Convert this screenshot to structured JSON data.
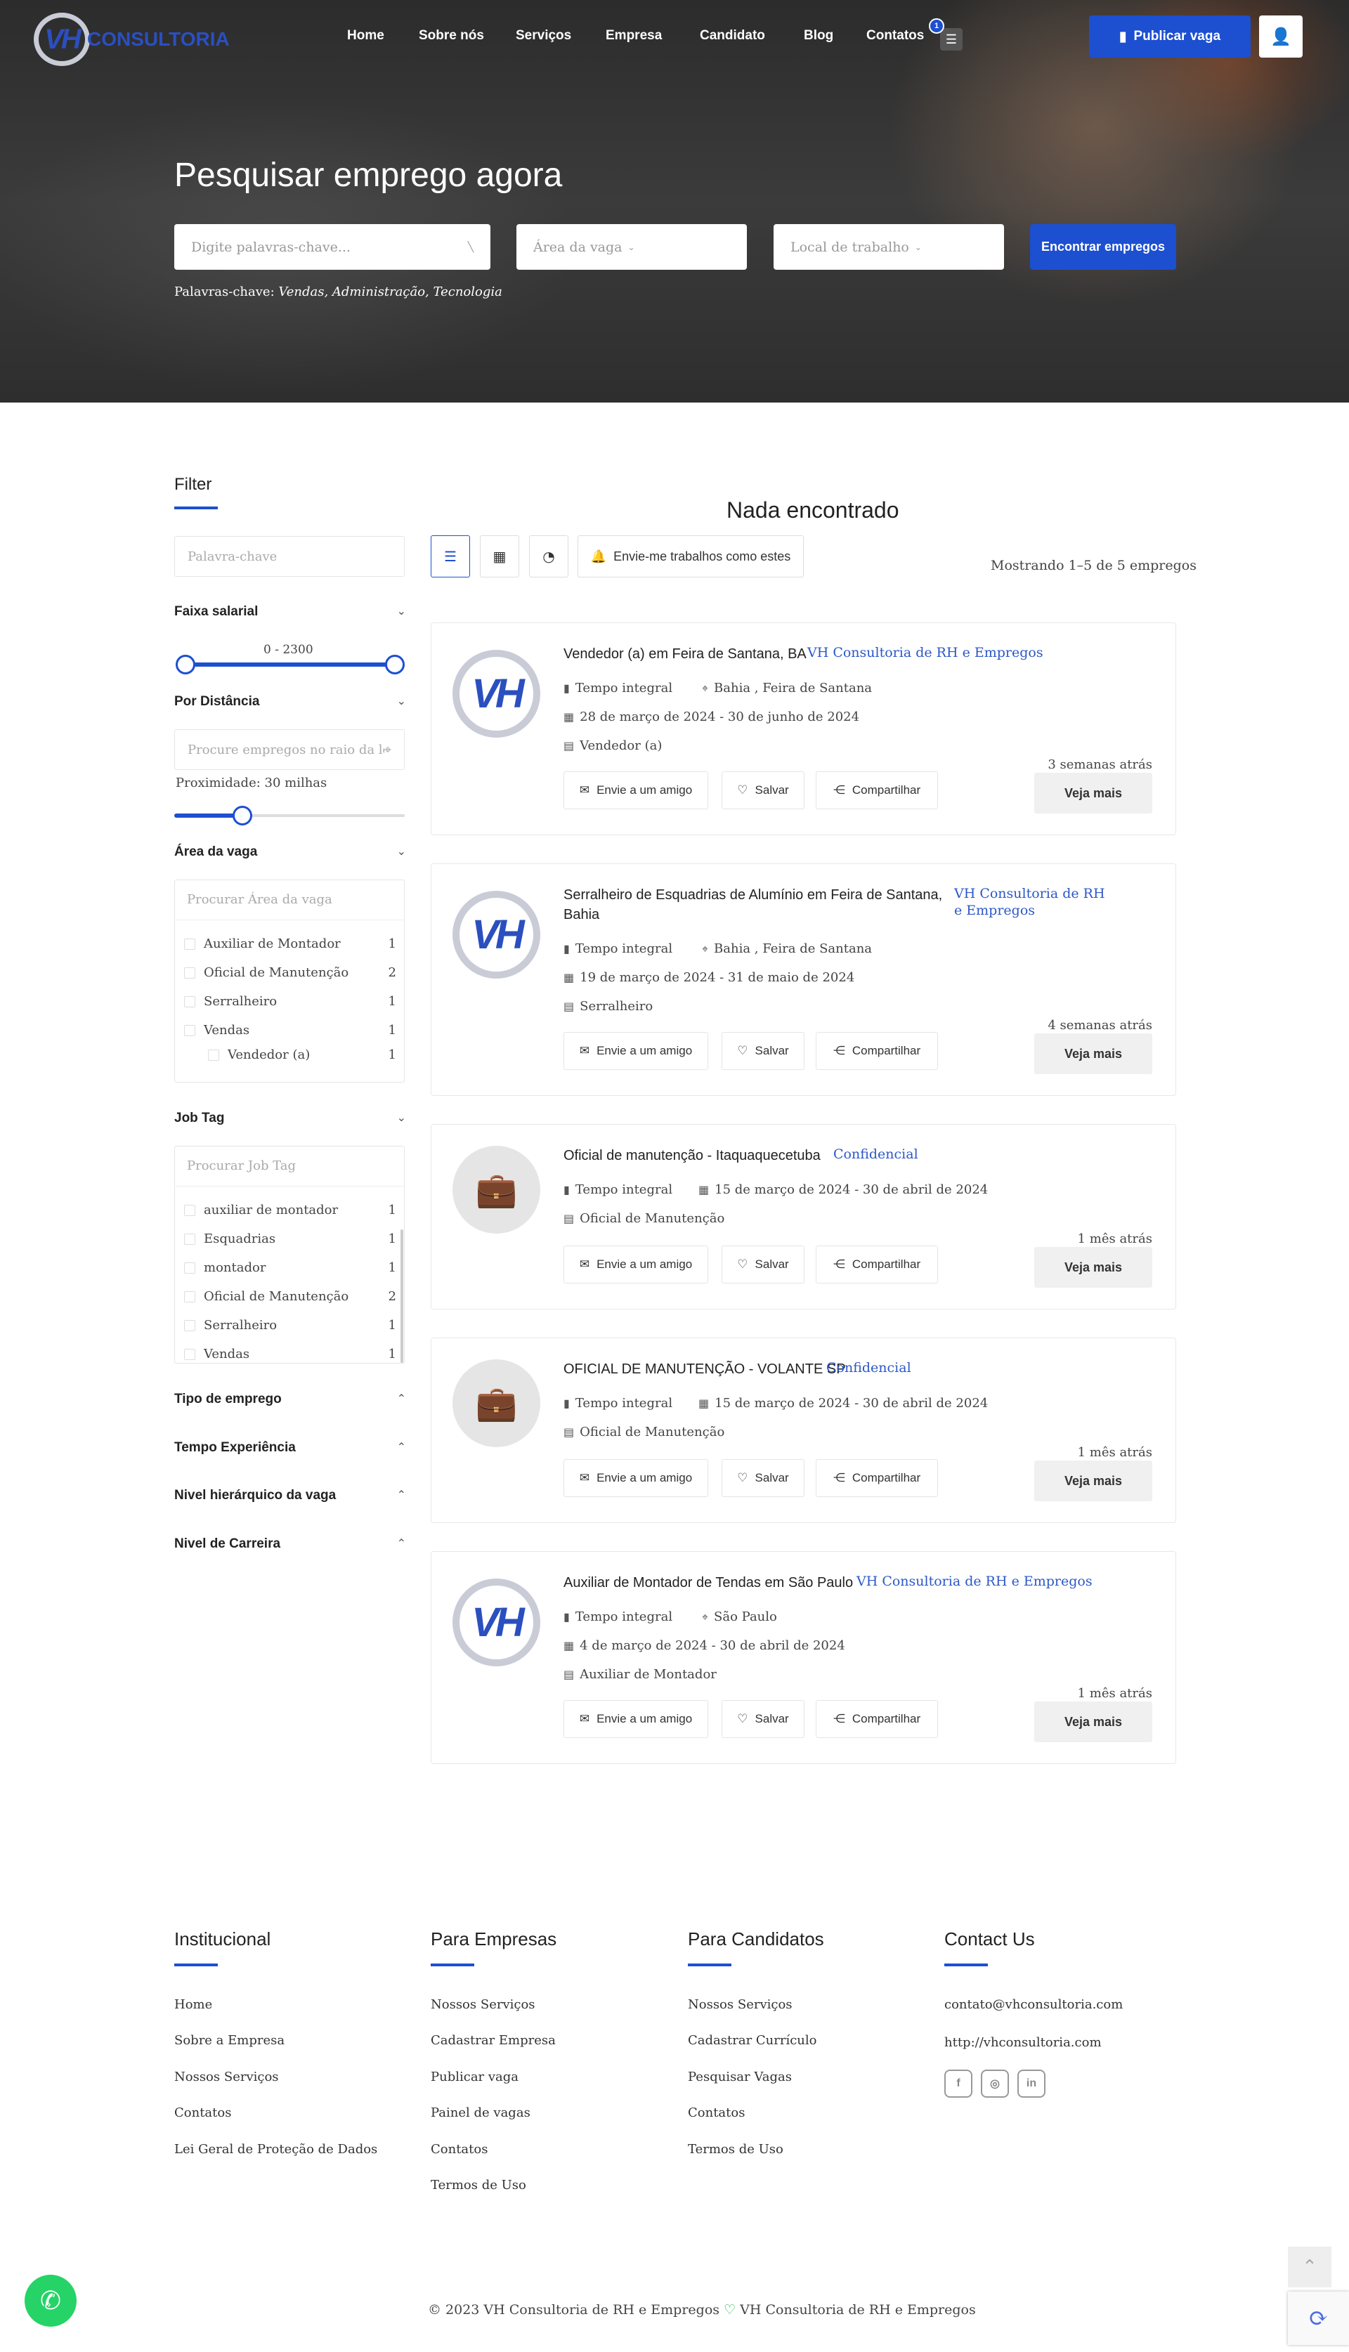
{
  "header": {
    "logo_text": "CONSULTORIA",
    "logo_mark": "VH",
    "nav": [
      "Home",
      "Sobre nós",
      "Serviços",
      "Empresa",
      "Candidato",
      "Blog",
      "Contatos"
    ],
    "cart_count": "1",
    "post_job_label": "Publicar vaga"
  },
  "hero": {
    "title": "Pesquisar emprego agora",
    "keyword_placeholder": "Digite palavras-chave...",
    "area_placeholder": "Área da vaga",
    "location_placeholder": "Local de trabalho",
    "search_button": "Encontrar empregos",
    "keywords_label": "Palavras-chave:",
    "keywords": "Vendas, Administração, Tecnologia"
  },
  "sidebar": {
    "title": "Filter",
    "keyword_placeholder": "Palavra-chave",
    "salary_title": "Faixa salarial",
    "salary_range": "0 - 2300",
    "distance_title": "Por Distância",
    "distance_placeholder": "Procure empregos no raio da localização",
    "proximity_label": "Proximidade: 30 milhas",
    "area_title": "Área da vaga",
    "area_placeholder": "Procurar Área da vaga",
    "areas": [
      {
        "label": "Auxiliar de Montador",
        "count": "1"
      },
      {
        "label": "Oficial de Manutenção",
        "count": "2"
      },
      {
        "label": "Serralheiro",
        "count": "1"
      },
      {
        "label": "Vendas",
        "count": "1"
      },
      {
        "label": "Vendedor (a)",
        "count": "1"
      }
    ],
    "tag_title": "Job Tag",
    "tag_placeholder": "Procurar Job Tag",
    "tags": [
      {
        "label": "auxiliar de montador",
        "count": "1"
      },
      {
        "label": "Esquadrias",
        "count": "1"
      },
      {
        "label": "montador",
        "count": "1"
      },
      {
        "label": "Oficial de Manutenção",
        "count": "2"
      },
      {
        "label": "Serralheiro",
        "count": "1"
      },
      {
        "label": "Vendas",
        "count": "1"
      }
    ],
    "collapsed_sections": [
      "Tipo de emprego",
      "Tempo Experiência",
      "Nivel hierárquico da vaga",
      "Nivel de Carreira"
    ]
  },
  "results": {
    "heading": "Nada encontrado",
    "alert_button": "Envie-me trabalhos como estes",
    "showing": "Mostrando 1–5 de 5 empregos",
    "action_labels": {
      "share_friend": "Envie a um amigo",
      "save": "Salvar",
      "share": "Compartilhar",
      "more": "Veja mais"
    },
    "jobs": [
      {
        "title": "Vendedor (a) em Feira de Santana, BA",
        "company": "VH Consultoria de RH e Empregos",
        "type": "Tempo integral",
        "location": "Bahia , Feira de Santana",
        "dates": "28 de março de 2024 - 30 de junho de 2024",
        "category": "Vendedor (a)",
        "ago": "3 semanas atrás",
        "logo": "VH"
      },
      {
        "title": "Serralheiro de Esquadrias de Alumínio em Feira de Santana, Bahia",
        "company": "VH Consultoria de RH e Empregos",
        "type": "Tempo integral",
        "location": "Bahia , Feira de Santana",
        "dates": "19 de março de 2024 - 31 de maio de 2024",
        "category": "Serralheiro",
        "ago": "4 semanas atrás",
        "logo": "VH"
      },
      {
        "title": "Oficial de manutenção - Itaquaquecetuba",
        "company": "Confidencial",
        "type": "Tempo integral",
        "location": "",
        "dates": "15 de março de 2024 - 30 de abril de 2024",
        "category": "Oficial de Manutenção",
        "ago": "1 mês atrás",
        "logo": "briefcase"
      },
      {
        "title": "OFICIAL DE MANUTENÇÃO - VOLANTE SP",
        "company": "Confidencial",
        "type": "Tempo integral",
        "location": "",
        "dates": "15 de março de 2024 - 30 de abril de 2024",
        "category": "Oficial de Manutenção",
        "ago": "1 mês atrás",
        "logo": "briefcase"
      },
      {
        "title": "Auxiliar de Montador de Tendas em São Paulo",
        "company": "VH Consultoria de RH e Empregos",
        "type": "Tempo integral",
        "location": "São Paulo",
        "dates": "4 de março de 2024 - 30 de abril de 2024",
        "category": "Auxiliar de Montador",
        "ago": "1 mês atrás",
        "logo": "VH"
      }
    ]
  },
  "footer": {
    "institutional": {
      "title": "Institucional",
      "links": [
        "Home",
        "Sobre a Empresa",
        "Nossos Serviços",
        "Contatos",
        "Lei Geral de Proteção de Dados"
      ]
    },
    "companies": {
      "title": "Para Empresas",
      "links": [
        "Nossos Serviços",
        "Cadastrar Empresa",
        "Publicar vaga",
        "Painel de vagas",
        "Contatos",
        "Termos de Uso"
      ]
    },
    "candidates": {
      "title": "Para Candidatos",
      "links": [
        "Nossos Serviços",
        "Cadastrar Currículo",
        "Pesquisar Vagas",
        "Contatos",
        "Termos de Uso"
      ]
    },
    "contact": {
      "title": "Contact Us",
      "email": "contato@vhconsultoria.com",
      "url": "http://vhconsultoria.com"
    },
    "copyright_left": "© 2023 VH Consultoria de RH e Empregos",
    "copyright_right": "VH Consultoria de RH e Empregos"
  },
  "colors": {
    "accent": "#1d4fd1",
    "company_link": "#2b57c8",
    "whatsapp": "#25d366"
  }
}
